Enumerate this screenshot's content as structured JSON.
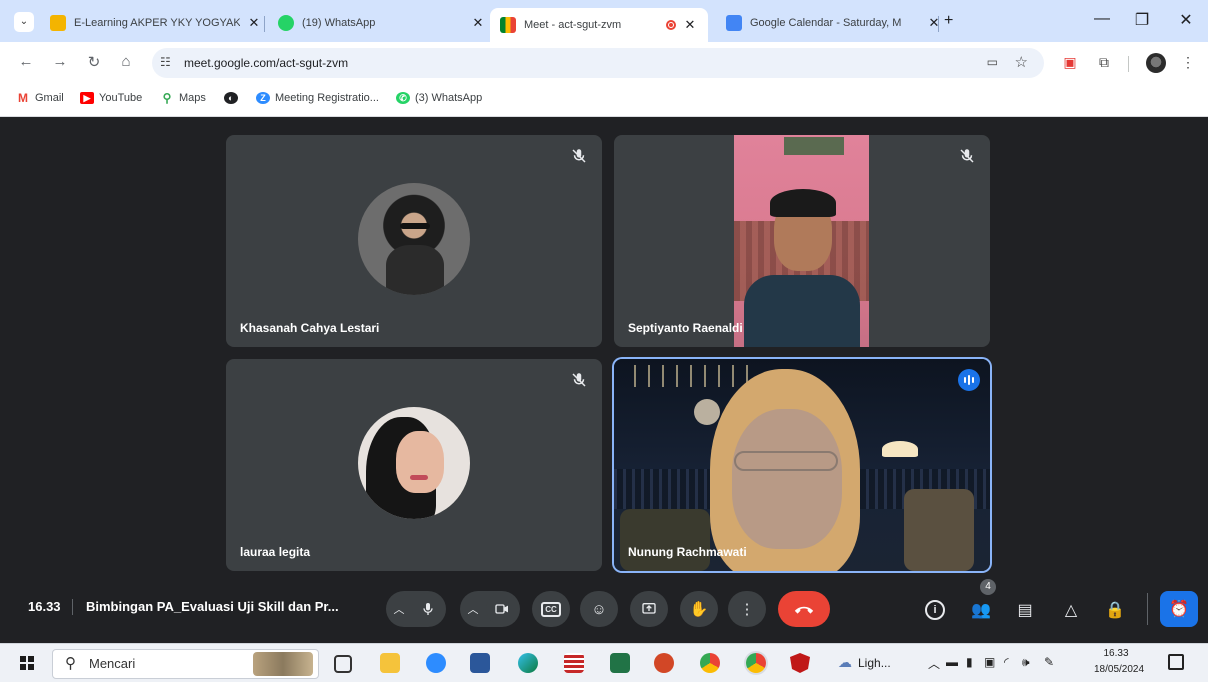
{
  "tabs": [
    {
      "title": "E-Learning AKPER YKY YOGYAK",
      "active": false
    },
    {
      "title": "(19) WhatsApp",
      "active": false
    },
    {
      "title": "Meet - act-sgut-zvm",
      "active": true
    },
    {
      "title": "Google Calendar - Saturday, M",
      "active": false
    }
  ],
  "new_tab_label": "+",
  "url": "meet.google.com/act-sgut-zvm",
  "bookmarks": [
    "Gmail",
    "YouTube",
    "Maps",
    "Meeting Registratio...",
    "(3) WhatsApp"
  ],
  "participants": [
    {
      "name": "Khasanah Cahya Lestari",
      "muted": true,
      "speaking": false
    },
    {
      "name": "Septiyanto Raenaldi",
      "muted": true,
      "speaking": false
    },
    {
      "name": "lauraa legita",
      "muted": true,
      "speaking": false
    },
    {
      "name": "Nunung Rachmawati",
      "muted": false,
      "speaking": true
    }
  ],
  "meeting": {
    "time": "16.33",
    "title": "Bimbingan PA_Evaluasi Uji Skill dan Pr...",
    "people_count": "4"
  },
  "taskbar": {
    "search_placeholder": "Mencari",
    "weather_label": "Ligh...",
    "clock_time": "16.33",
    "clock_date": "18/05/2024"
  },
  "colors": {
    "tab_bar": "#d3e3fd",
    "meet_bg": "#202124",
    "tile_bg": "#3c4043",
    "end_call": "#ea4335",
    "accent": "#1a73e8"
  }
}
